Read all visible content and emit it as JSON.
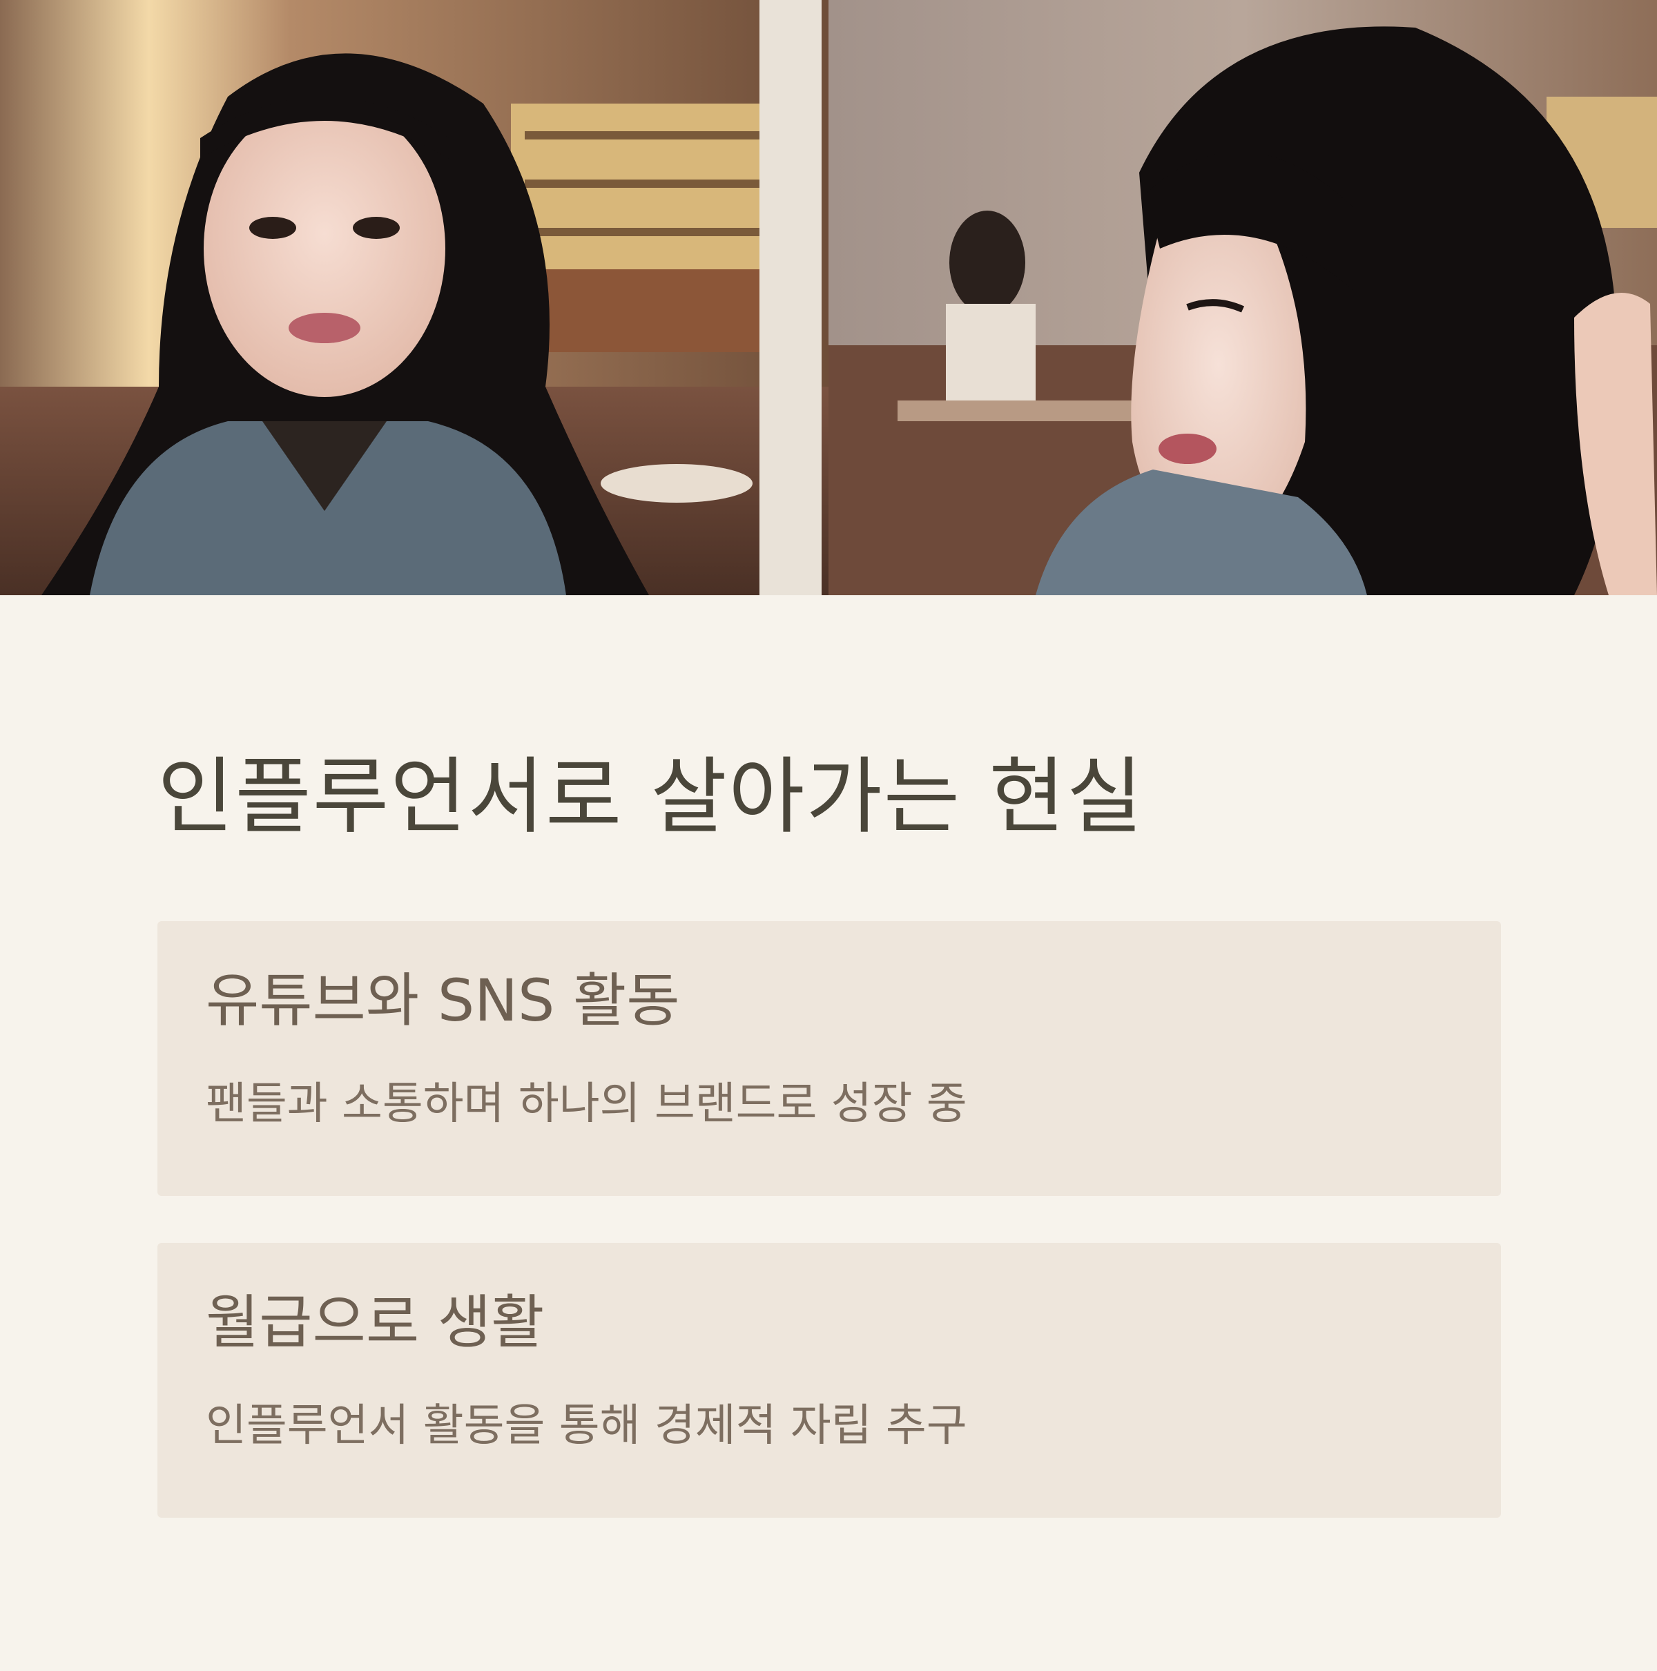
{
  "hero": {
    "photos": [
      {
        "icon": "portrait-photo-left",
        "alt_visible": false
      },
      {
        "icon": "portrait-photo-right",
        "alt_visible": false
      }
    ]
  },
  "page": {
    "title": "인플루언서로 살아가는 현실"
  },
  "cards": [
    {
      "title": "유튜브와 SNS 활동",
      "description": "팬들과 소통하며 하나의 브랜드로 성장 중"
    },
    {
      "title": "월급으로 생활",
      "description": "인플루언서 활동을 통해 경제적 자립 추구"
    }
  ],
  "colors": {
    "background": "#f7f3ec",
    "card": "#eee6dc",
    "title_text": "#4a463a",
    "card_title_text": "#6e6052",
    "card_desc_text": "#7d6e60"
  }
}
